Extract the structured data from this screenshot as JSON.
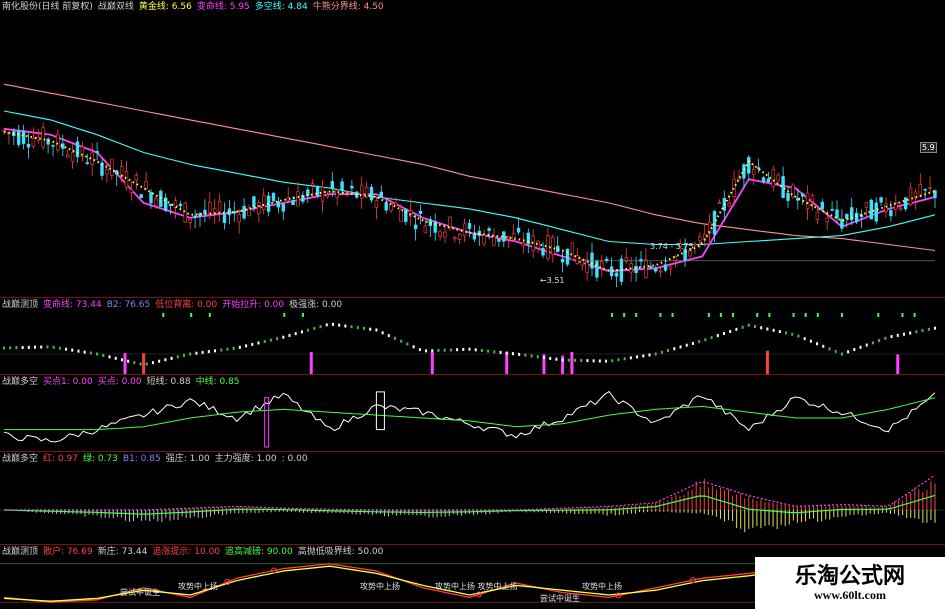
{
  "main": {
    "header": [
      {
        "text": "南化股份(日线 前复权)",
        "color": "#d0d0d0"
      },
      {
        "text": "战巅双线",
        "color": "#d0d0d0"
      },
      {
        "text": "黄金线: 6.56",
        "color": "#ffff40"
      },
      {
        "text": "变命线: 5.95",
        "color": "#ff40ff"
      },
      {
        "text": "多空线: 4.84",
        "color": "#40ffff"
      },
      {
        "text": "牛熊分界线: 4.50",
        "color": "#ff9090"
      }
    ],
    "labels": {
      "price_right": "5.9",
      "low_mark": "3.74 - 3.75",
      "low_price": "←3.51"
    }
  },
  "p2": {
    "header": [
      {
        "text": "战巅测顶",
        "color": "#d0d0d0"
      },
      {
        "text": "变命线: 73.44",
        "color": "#ff40ff"
      },
      {
        "text": "B2: 76.65",
        "color": "#8080ff"
      },
      {
        "text": "低位背离: 0.00",
        "color": "#ff4040"
      },
      {
        "text": "开始拉升: 0.00",
        "color": "#ff40ff"
      },
      {
        "text": "极强涨: 0.00",
        "color": "#d0d0d0"
      }
    ]
  },
  "p3": {
    "header": [
      {
        "text": "战巅多空",
        "color": "#d0d0d0"
      },
      {
        "text": "买点1: 0.00",
        "color": "#ff40ff"
      },
      {
        "text": "买点: 0.00",
        "color": "#ff40ff"
      },
      {
        "text": "短线: 0.88",
        "color": "#d0d0d0"
      },
      {
        "text": "中线: 0.85",
        "color": "#40ff40"
      }
    ]
  },
  "p4": {
    "header": [
      {
        "text": "战巅多空",
        "color": "#d0d0d0"
      },
      {
        "text": "红: 0.97",
        "color": "#ff4040"
      },
      {
        "text": "绿: 0.73",
        "color": "#40ff40"
      },
      {
        "text": "B1: 0.85",
        "color": "#8080ff"
      },
      {
        "text": "强庄: 1.00",
        "color": "#d0d0d0"
      },
      {
        "text": "主力强度: 1.00",
        "color": "#d0d0d0"
      },
      {
        "text": ": 0.00",
        "color": "#d0d0d0"
      }
    ]
  },
  "p5": {
    "header": [
      {
        "text": "战巅测顶",
        "color": "#d0d0d0"
      },
      {
        "text": "散户: 76.69",
        "color": "#ff4040"
      },
      {
        "text": "新庄: 73.44",
        "color": "#d0d0d0"
      },
      {
        "text": "追涨提示: 10.00",
        "color": "#ff4040"
      },
      {
        "text": "追高减磅: 90.00",
        "color": "#40ff40"
      },
      {
        "text": "高抛低吸界线: 50.00",
        "color": "#d0d0d0"
      }
    ],
    "tags": [
      "尝试中诞生",
      "攻势中上扬",
      "攻势中上扬",
      "攻势中上扬 攻势中上扬",
      "攻势中上扬",
      "尝试中诞生"
    ]
  },
  "watermark": {
    "cn": "乐淘公式网",
    "url": "www.60lt.com"
  },
  "chart_data": [
    {
      "type": "line",
      "title": "南化股份(日线 前复权) 战巅双线",
      "x": [
        0,
        5,
        10,
        15,
        20,
        25,
        30,
        35,
        40,
        45,
        50,
        55,
        60,
        65,
        70,
        75,
        80,
        85,
        90,
        95,
        100
      ],
      "series": [
        {
          "name": "黄金线",
          "color": "#ffff40",
          "values": [
            8.6,
            8.3,
            7.6,
            6.7,
            5.8,
            5.9,
            6.3,
            6.6,
            6.4,
            5.6,
            5.2,
            5.0,
            4.6,
            3.9,
            4.1,
            4.8,
            7.6,
            6.4,
            5.6,
            6.1,
            6.6
          ]
        },
        {
          "name": "变命线",
          "color": "#ff40ff",
          "values": [
            8.7,
            8.5,
            7.9,
            6.2,
            5.7,
            5.9,
            6.2,
            6.5,
            6.5,
            5.7,
            5.2,
            4.9,
            4.4,
            3.9,
            4.0,
            4.4,
            7.0,
            6.7,
            5.4,
            6.0,
            6.4
          ]
        },
        {
          "name": "多空线",
          "color": "#40ffff",
          "values": [
            9.3,
            9.0,
            8.5,
            7.9,
            7.5,
            7.2,
            6.9,
            6.7,
            6.4,
            6.2,
            6.0,
            5.7,
            5.3,
            4.9,
            4.8,
            4.8,
            4.9,
            5.0,
            5.1,
            5.4,
            5.8
          ]
        },
        {
          "name": "牛熊分界线",
          "color": "#ff9090",
          "values": [
            10.2,
            9.9,
            9.6,
            9.3,
            9.0,
            8.7,
            8.4,
            8.1,
            7.8,
            7.5,
            7.1,
            6.8,
            6.5,
            6.2,
            5.8,
            5.5,
            5.3,
            5.1,
            5.0,
            4.8,
            4.6
          ]
        }
      ],
      "ylim": [
        3.2,
        12.5
      ]
    },
    {
      "type": "line",
      "title": "战巅测顶",
      "x": [
        0,
        5,
        10,
        15,
        20,
        25,
        30,
        35,
        40,
        45,
        50,
        55,
        60,
        65,
        70,
        75,
        80,
        85,
        90,
        95,
        100
      ],
      "series": [
        {
          "name": "变命线",
          "color": "#ffffff",
          "values": [
            40,
            42,
            30,
            12,
            30,
            40,
            58,
            80,
            70,
            35,
            38,
            30,
            20,
            18,
            30,
            52,
            78,
            62,
            30,
            58,
            73
          ]
        }
      ],
      "bars": [
        {
          "x": 13,
          "value": 28,
          "color": "#ff40ff"
        },
        {
          "x": 15,
          "value": 28,
          "color": "#ff4040"
        },
        {
          "x": 33,
          "value": 30,
          "color": "#ff40ff"
        },
        {
          "x": 46,
          "value": 30,
          "color": "#ff40ff"
        },
        {
          "x": 54,
          "value": 30,
          "color": "#ff40ff"
        },
        {
          "x": 58,
          "value": 26,
          "color": "#ff40ff"
        },
        {
          "x": 60,
          "value": 24,
          "color": "#ff40ff"
        },
        {
          "x": 61,
          "value": 30,
          "color": "#ff40ff"
        },
        {
          "x": 82,
          "value": 32,
          "color": "#ff4040"
        },
        {
          "x": 96,
          "value": 26,
          "color": "#ff40ff"
        }
      ],
      "ylim": [
        0,
        100
      ]
    },
    {
      "type": "line",
      "title": "战巅多空",
      "x": [
        0,
        5,
        10,
        15,
        20,
        25,
        30,
        35,
        40,
        45,
        50,
        55,
        60,
        65,
        70,
        75,
        80,
        85,
        90,
        95,
        100
      ],
      "series": [
        {
          "name": "短线",
          "color": "#ffffff",
          "values": [
            0.2,
            0.1,
            0.3,
            0.55,
            0.8,
            0.5,
            0.9,
            0.3,
            0.7,
            0.6,
            0.4,
            0.2,
            0.5,
            0.9,
            0.4,
            0.9,
            0.3,
            0.85,
            0.6,
            0.3,
            0.88
          ]
        },
        {
          "name": "中线",
          "color": "#40ff40",
          "values": [
            0.3,
            0.3,
            0.3,
            0.35,
            0.5,
            0.6,
            0.65,
            0.6,
            0.55,
            0.5,
            0.45,
            0.35,
            0.4,
            0.55,
            0.65,
            0.7,
            0.6,
            0.5,
            0.5,
            0.65,
            0.85
          ]
        }
      ],
      "ylim": [
        0,
        1
      ]
    },
    {
      "type": "bar",
      "title": "战巅多空",
      "x": [
        0,
        5,
        10,
        15,
        20,
        25,
        30,
        35,
        40,
        45,
        50,
        55,
        60,
        65,
        70,
        75,
        80,
        85,
        90,
        95,
        100
      ],
      "series": [
        {
          "name": "红",
          "color": "#ff4040",
          "values": [
            0,
            0,
            0,
            0,
            0.05,
            0.1,
            0.05,
            0.02,
            0,
            0,
            0,
            0,
            0.05,
            0.1,
            0.2,
            0.8,
            0.4,
            0.1,
            0.15,
            0.1,
            0.97
          ]
        },
        {
          "name": "绿",
          "color": "#e0e060",
          "values": [
            0,
            -0.1,
            -0.2,
            -0.35,
            -0.25,
            -0.1,
            -0.05,
            -0.1,
            -0.15,
            -0.2,
            -0.15,
            -0.05,
            -0.1,
            -0.15,
            -0.05,
            -0.1,
            -0.6,
            -0.4,
            -0.2,
            -0.1,
            -0.4
          ]
        }
      ],
      "ylim": [
        -1,
        1
      ]
    },
    {
      "type": "line",
      "title": "战巅测顶",
      "x": [
        0,
        5,
        10,
        15,
        20,
        25,
        30,
        35,
        40,
        45,
        50,
        55,
        60,
        65,
        70,
        75,
        80,
        85,
        90,
        95,
        100
      ],
      "series": [
        {
          "name": "散户",
          "color": "#ff4040",
          "values": [
            20,
            10,
            15,
            40,
            20,
            60,
            80,
            90,
            75,
            40,
            20,
            50,
            30,
            20,
            40,
            60,
            70,
            85,
            80,
            60,
            30
          ]
        },
        {
          "name": "新庄",
          "color": "#ffff40",
          "values": [
            18,
            12,
            18,
            35,
            25,
            55,
            75,
            85,
            70,
            45,
            25,
            45,
            35,
            25,
            35,
            55,
            65,
            80,
            75,
            55,
            28
          ]
        }
      ],
      "ylim": [
        0,
        100
      ]
    }
  ]
}
